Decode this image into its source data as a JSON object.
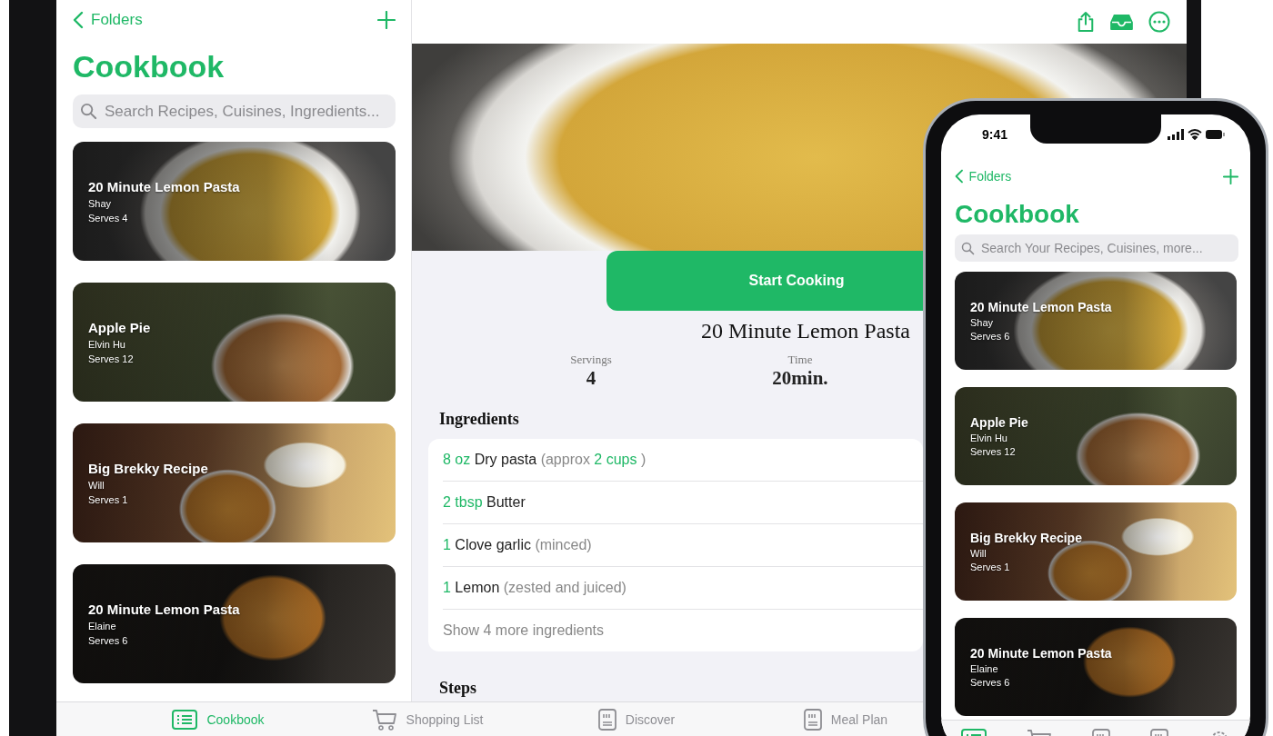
{
  "ipad": {
    "back": "Folders",
    "title": "Cookbook",
    "search": {
      "placeholder": "Search Recipes, Cuisines, Ingredients..."
    },
    "recipes": [
      {
        "title": "20 Minute Lemon Pasta",
        "author": "Shay",
        "serves": "Serves 4",
        "kind": "pasta"
      },
      {
        "title": "Apple Pie",
        "author": "Elvin Hu",
        "serves": "Serves 12",
        "kind": "pie"
      },
      {
        "title": "Big Brekky Recipe",
        "author": "Will",
        "serves": "Serves 1",
        "kind": "breakfast"
      },
      {
        "title": "20 Minute Lemon Pasta",
        "author": "Elaine",
        "serves": "Serves 6",
        "kind": "tray"
      }
    ],
    "detail": {
      "start_button": "Start Cooking",
      "title": "20 Minute Lemon Pasta",
      "stats": [
        {
          "label": "Servings",
          "value": "4"
        },
        {
          "label": "Time",
          "value": "20min."
        }
      ],
      "ingredients_heading": "Ingredients",
      "ingredients": [
        [
          {
            "kind": "amount",
            "text": "8 oz"
          },
          {
            "kind": "name",
            "text": "Dry pasta"
          },
          {
            "kind": "note",
            "text": "(approx"
          },
          {
            "kind": "amount",
            "text": "2 cups"
          },
          {
            "kind": "note",
            "text": ")"
          }
        ],
        [
          {
            "kind": "amount",
            "text": "2 tbsp"
          },
          {
            "kind": "name",
            "text": "Butter"
          }
        ],
        [
          {
            "kind": "amount",
            "text": "1"
          },
          {
            "kind": "name",
            "text": "Clove garlic"
          },
          {
            "kind": "note",
            "text": "(minced)"
          }
        ],
        [
          {
            "kind": "amount",
            "text": "1"
          },
          {
            "kind": "name",
            "text": "Lemon"
          },
          {
            "kind": "note",
            "text": "(zested and juiced)"
          }
        ]
      ],
      "more_link": "Show 4 more ingredients",
      "steps_heading": "Steps"
    },
    "tabs": [
      {
        "label": "Cookbook",
        "selected": true
      },
      {
        "label": "Shopping List",
        "selected": false
      },
      {
        "label": "Discover",
        "selected": false
      },
      {
        "label": "Meal Plan",
        "selected": false
      }
    ]
  },
  "iphone": {
    "time": "9:41",
    "back": "Folders",
    "title": "Cookbook",
    "search": {
      "placeholder": "Search Your Recipes, Cuisines, more..."
    },
    "recipes": [
      {
        "title": "20 Minute Lemon Pasta",
        "author": "Shay",
        "serves": "Serves 6",
        "kind": "pasta"
      },
      {
        "title": "Apple Pie",
        "author": "Elvin Hu",
        "serves": "Serves 12",
        "kind": "pie"
      },
      {
        "title": "Big Brekky Recipe",
        "author": "Will",
        "serves": "Serves 1",
        "kind": "breakfast"
      },
      {
        "title": "20 Minute Lemon Pasta",
        "author": "Elaine",
        "serves": "Serves 6",
        "kind": "tray"
      }
    ],
    "tabs": [
      {
        "selected": true
      },
      {
        "selected": false
      },
      {
        "selected": false
      },
      {
        "selected": false
      },
      {
        "selected": false
      }
    ]
  }
}
